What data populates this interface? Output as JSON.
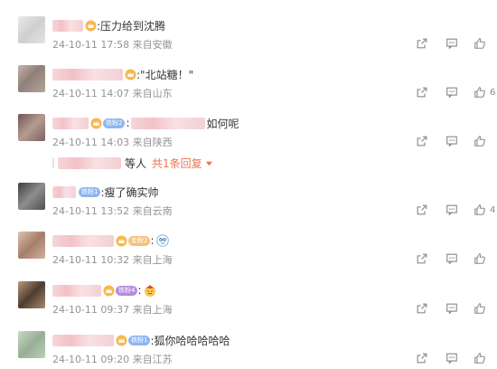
{
  "comments": [
    {
      "text": ":压力给到沈腾",
      "meta": "24-10-11 17:58 来自安徽",
      "likes": "",
      "has_badge": false,
      "colors": [
        "#e3e3e3",
        "#c9c9c9"
      ]
    },
    {
      "text": ":\"北站糖！\"",
      "meta": "24-10-11 14:07 来自山东",
      "likes": "6",
      "has_badge": false,
      "colors": [
        "#b7a7a0",
        "#8c7d77"
      ]
    },
    {
      "text": "如何呢",
      "meta": "24-10-11 14:03 来自陕西",
      "likes": "",
      "badge": "铁粉2",
      "colors": [
        "#7a6060",
        "#b49a8e"
      ]
    },
    {
      "text": ":瘦了确实帅",
      "meta": "24-10-11 13:52 来自云南",
      "likes": "4",
      "badge": "铁粉1",
      "colors": [
        "#4a4a4a",
        "#8e8e8e"
      ]
    },
    {
      "text": ":",
      "meta": "24-10-11 10:32 来自上海",
      "likes": "",
      "badge": "金粉2",
      "colors": [
        "#d8b8a6",
        "#b08a78"
      ]
    },
    {
      "text": ":",
      "meta": "24-10-11 09:37 来自上海",
      "likes": "",
      "badge": "铁粉4",
      "colors": [
        "#b09478",
        "#5a4838"
      ]
    },
    {
      "text": ":狐你哈哈哈哈哈",
      "meta": "24-10-11 09:20 来自江苏",
      "likes": "",
      "badge": "铁粉1",
      "colors": [
        "#bcd2b8",
        "#98b097"
      ]
    }
  ],
  "subreply": {
    "who_suffix": "等人",
    "more_label": "共1条回复"
  },
  "icons": {
    "share": "share-icon",
    "reply": "comment-icon",
    "like": "thumbs-up-icon",
    "crown": "vip-crown-icon"
  },
  "colors": {
    "accent": "#eb7350",
    "meta": "#939393",
    "icon": "#8a8a8a"
  }
}
